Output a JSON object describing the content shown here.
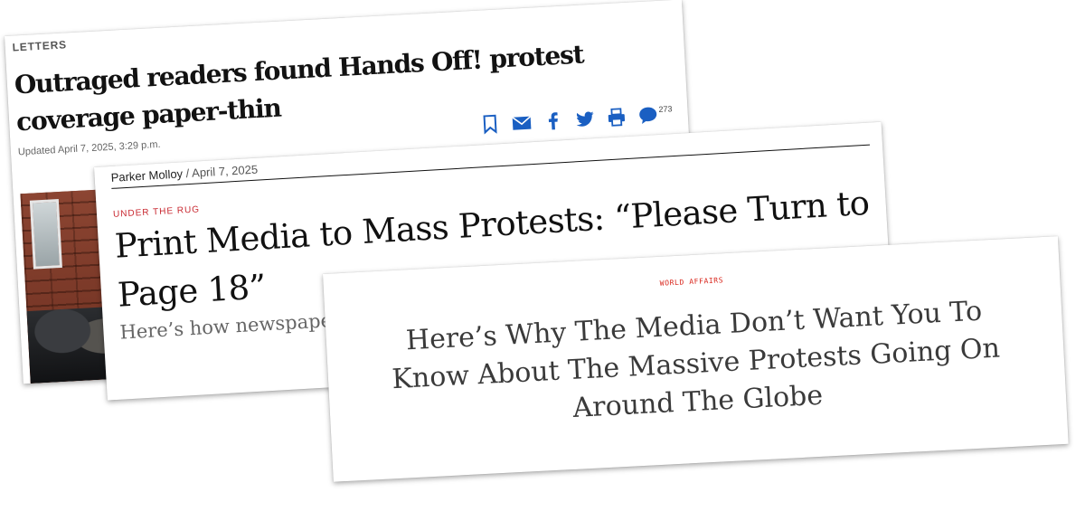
{
  "card1": {
    "section": "LETTERS",
    "headline": "Outraged readers found Hands Off! protest coverage paper-thin",
    "updated": "Updated April 7, 2025, 3:29 p.m.",
    "comment_count": "273",
    "icons": [
      "bookmark-icon",
      "email-icon",
      "facebook-icon",
      "twitter-icon",
      "print-icon",
      "comment-icon"
    ],
    "accent_color": "#1a5fc2"
  },
  "card2": {
    "author": "Parker Molloy",
    "separator": "/",
    "date": "April 7, 2025",
    "section": "UNDER THE RUG",
    "headline": "Print Media to Mass Protests: “Please Turn to Page 18”",
    "dek": "Here’s how newspapers covered the largest demonstrations since",
    "section_color": "#c8272f"
  },
  "card3": {
    "section": "WORLD AFFAIRS",
    "headline": "Here’s Why The Media Don’t Want You To Know About The Massive Protests Going On Around The Globe",
    "section_color": "#d9261c"
  }
}
